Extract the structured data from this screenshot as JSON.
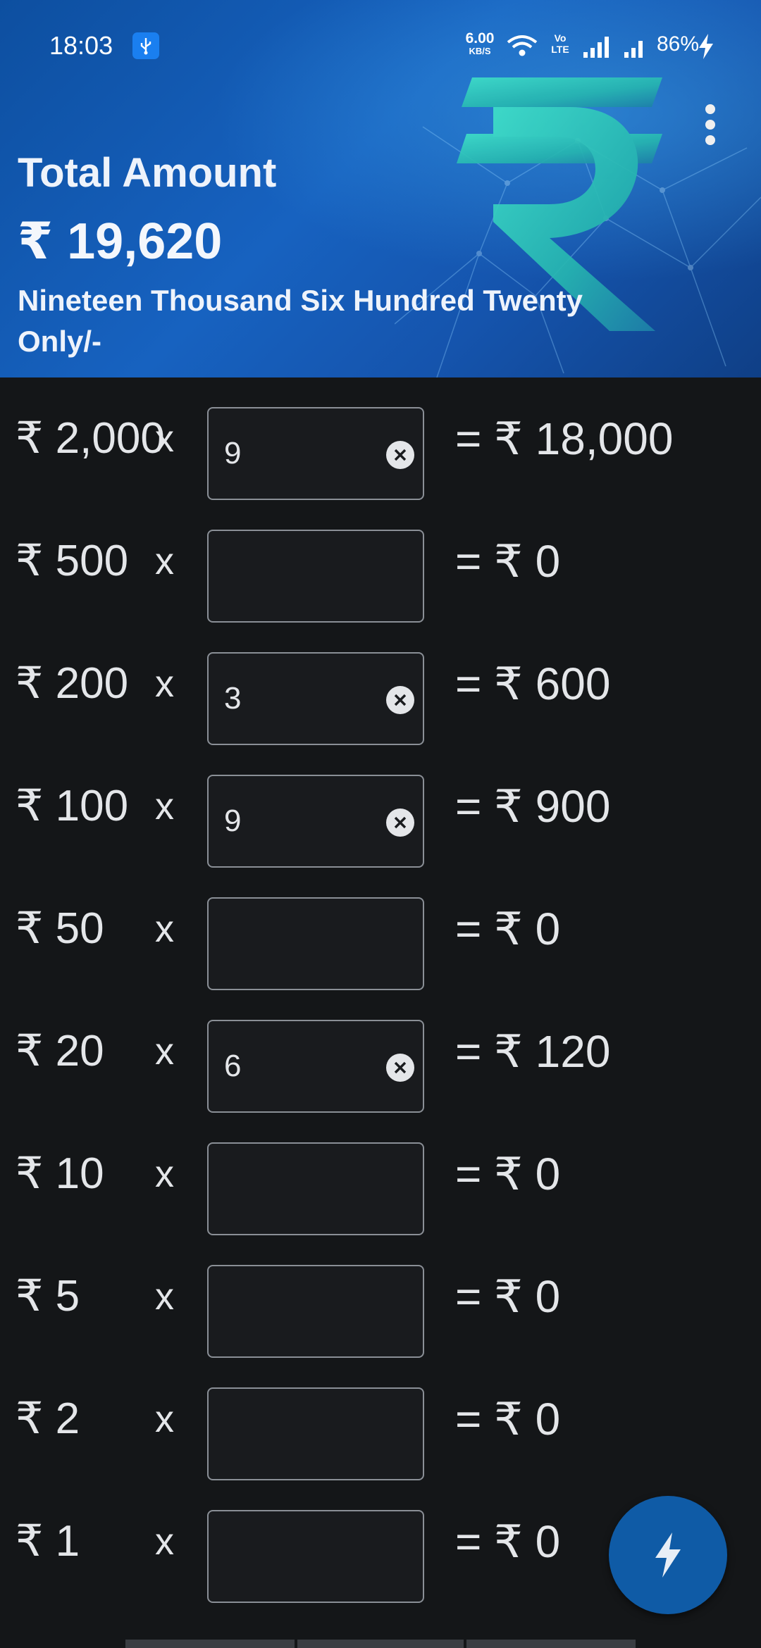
{
  "status_bar": {
    "time": "18:03",
    "net_speed_value": "6.00",
    "net_speed_unit": "KB/S",
    "volte_top": "Vo",
    "volte_bottom": "LTE",
    "battery": "86%",
    "icons": [
      "usb-icon",
      "wifi-icon",
      "volte-icon",
      "signal-icon",
      "signal-icon",
      "charging-icon"
    ]
  },
  "header": {
    "title": "Total Amount",
    "amount": "₹ 19,620",
    "amount_in_words": "Nineteen Thousand Six Hundred Twenty Only/-",
    "menu_icon": "more-vert-icon",
    "background_icon": "rupee-symbol-icon"
  },
  "rows": [
    {
      "denomination": "₹ 2,000",
      "times": "x",
      "count": "9",
      "result": "= ₹ 18,000"
    },
    {
      "denomination": "₹ 500",
      "times": "x",
      "count": "",
      "result": "= ₹ 0"
    },
    {
      "denomination": "₹ 200",
      "times": "x",
      "count": "3",
      "result": "= ₹ 600"
    },
    {
      "denomination": "₹ 100",
      "times": "x",
      "count": "9",
      "result": "= ₹ 900"
    },
    {
      "denomination": "₹ 50",
      "times": "x",
      "count": "",
      "result": "= ₹ 0"
    },
    {
      "denomination": "₹ 20",
      "times": "x",
      "count": "6",
      "result": "= ₹ 120"
    },
    {
      "denomination": "₹ 10",
      "times": "x",
      "count": "",
      "result": "= ₹ 0"
    },
    {
      "denomination": "₹ 5",
      "times": "x",
      "count": "",
      "result": "= ₹ 0"
    },
    {
      "denomination": "₹ 2",
      "times": "x",
      "count": "",
      "result": "= ₹ 0"
    },
    {
      "denomination": "₹ 1",
      "times": "x",
      "count": "",
      "result": "= ₹ 0"
    }
  ],
  "fab": {
    "icon": "flash-icon"
  },
  "colors": {
    "header_blue": "#1762c0",
    "background": "#141618",
    "fab": "#0f5ba6",
    "text": "#e4e6e9"
  }
}
